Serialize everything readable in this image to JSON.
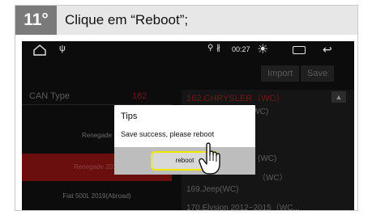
{
  "instruction": {
    "step": "11°",
    "text": "Clique em “Reboot”;"
  },
  "status_bar": {
    "time": "00:27",
    "icons": [
      "home-icon",
      "usb-icon",
      "location-icon",
      "bluetooth-icon",
      "brightness-icon",
      "window-icon",
      "back-icon"
    ]
  },
  "toolbar": {
    "import_label": "Import",
    "save_label": "Save"
  },
  "can_panel": {
    "label": "CAN Type",
    "value": "162",
    "selected_brand": "162.CHRYSLER（WC）",
    "models": [
      "Renegade",
      "Renegade 2019",
      "Fiat 500L 2019(Abroad)"
    ],
    "options": [
      "(WC)",
      "(WC)",
      "（WC）",
      "169.Jeep(WC)",
      "170.Elysion 2012~2015（WC..."
    ]
  },
  "dialog": {
    "title": "Tips",
    "message": "Save success, please reboot",
    "button_label": "reboot"
  },
  "colors": {
    "accent_highlight": "#f2e600",
    "selected_row": "#6a0e0e",
    "badge": "#7a7a7a"
  }
}
